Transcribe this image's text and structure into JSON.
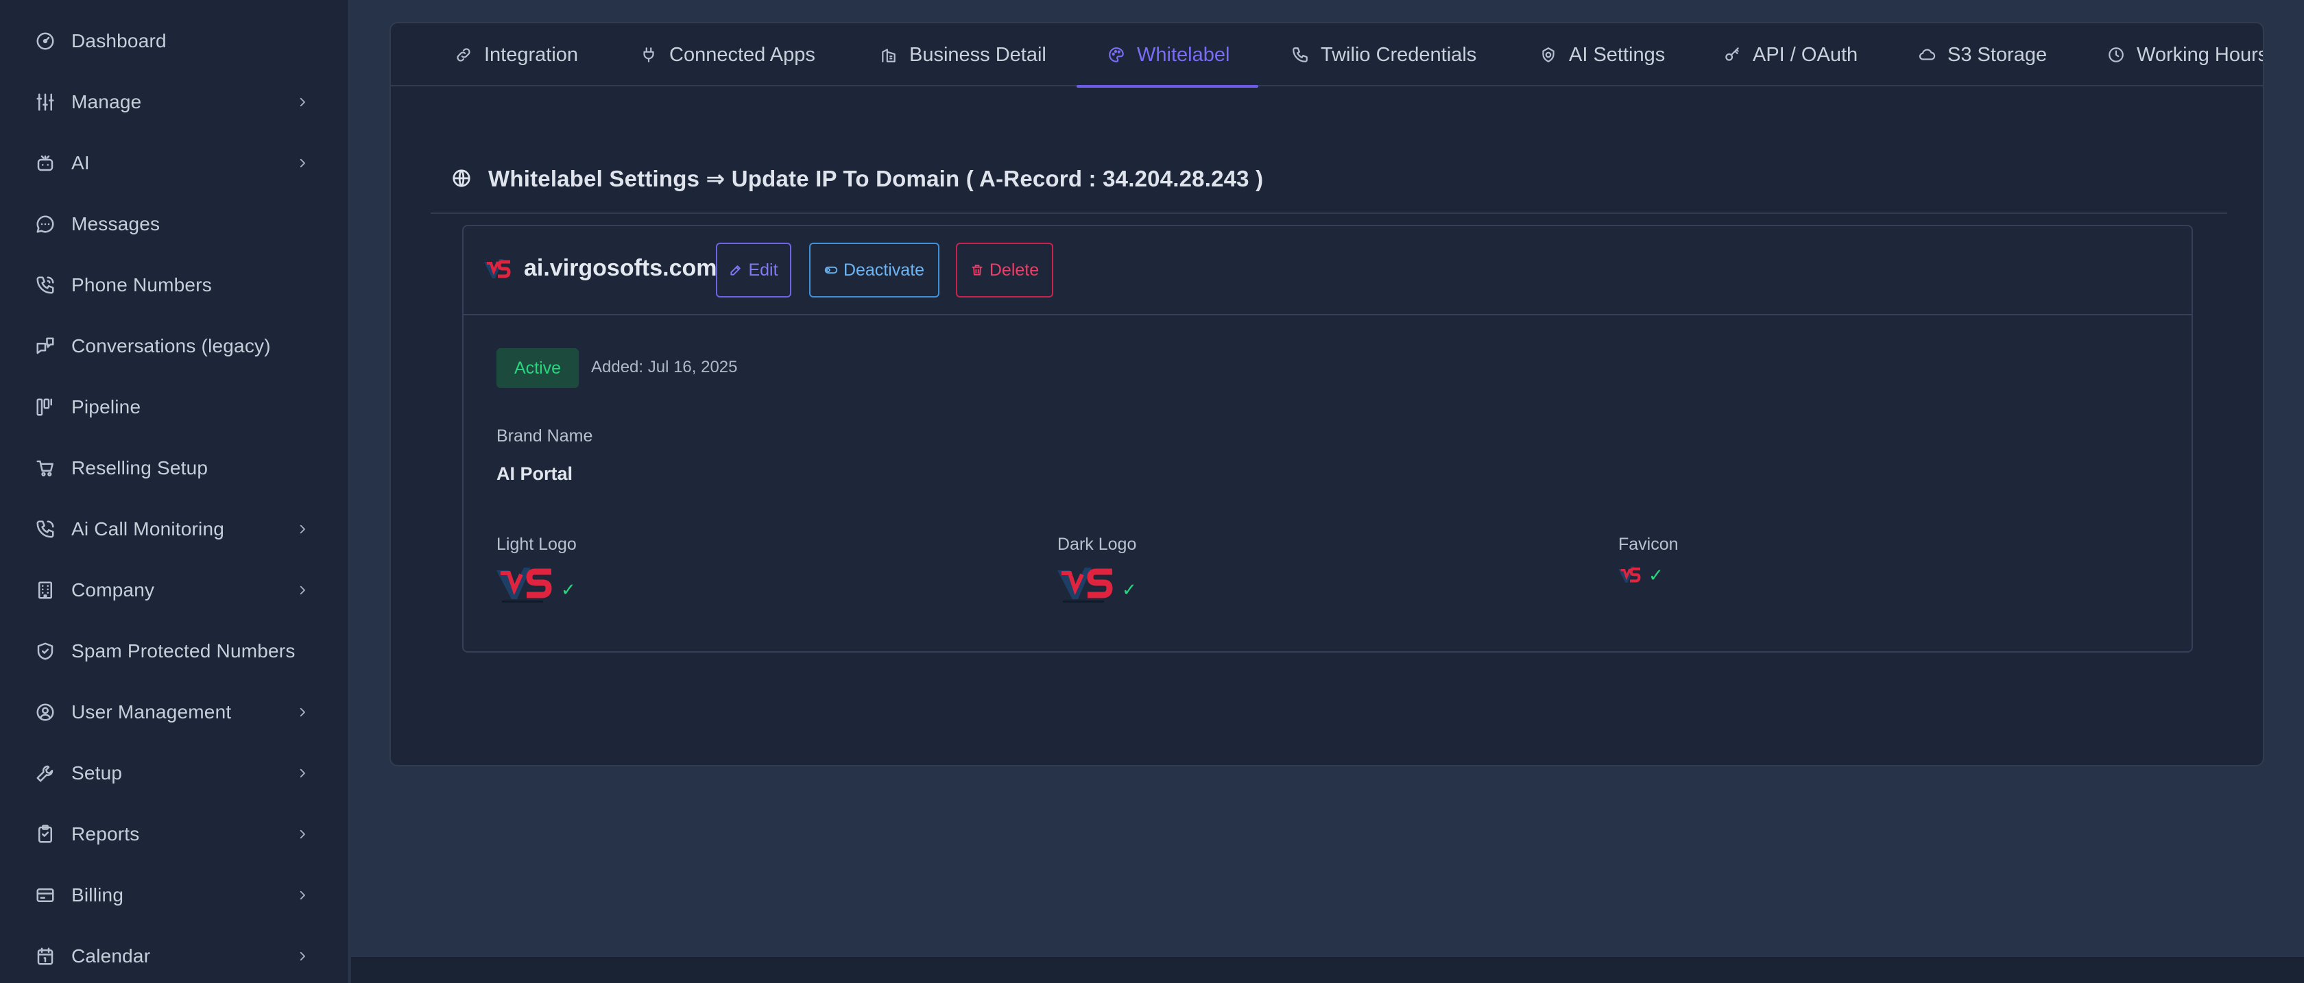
{
  "sidebar": {
    "items": [
      {
        "label": "Dashboard",
        "icon": "dashboard-icon",
        "has_children": false
      },
      {
        "label": "Manage",
        "icon": "sliders-icon",
        "has_children": true
      },
      {
        "label": "AI",
        "icon": "bot-icon",
        "has_children": true
      },
      {
        "label": "Messages",
        "icon": "chat-bubble-icon",
        "has_children": false
      },
      {
        "label": "Phone Numbers",
        "icon": "phone-icon",
        "has_children": false
      },
      {
        "label": "Conversations (legacy)",
        "icon": "conversations-icon",
        "has_children": false
      },
      {
        "label": "Pipeline",
        "icon": "pipeline-icon",
        "has_children": false
      },
      {
        "label": "Reselling Setup",
        "icon": "cart-icon",
        "has_children": false
      },
      {
        "label": "Ai Call Monitoring",
        "icon": "phone-call-icon",
        "has_children": true
      },
      {
        "label": "Company",
        "icon": "building-icon",
        "has_children": true
      },
      {
        "label": "Spam Protected Numbers",
        "icon": "shield-icon",
        "has_children": false
      },
      {
        "label": "User Management",
        "icon": "user-circle-icon",
        "has_children": true
      },
      {
        "label": "Setup",
        "icon": "wrench-icon",
        "has_children": true
      },
      {
        "label": "Reports",
        "icon": "clipboard-icon",
        "has_children": true
      },
      {
        "label": "Billing",
        "icon": "credit-card-icon",
        "has_children": true
      },
      {
        "label": "Calendar",
        "icon": "calendar-icon",
        "has_children": true
      }
    ]
  },
  "tabs": [
    {
      "label": "Integration",
      "icon": "link-icon",
      "active": false
    },
    {
      "label": "Connected Apps",
      "icon": "plug-icon",
      "active": false
    },
    {
      "label": "Business Detail",
      "icon": "building-icon",
      "active": false
    },
    {
      "label": "Whitelabel",
      "icon": "palette-icon",
      "active": true
    },
    {
      "label": "Twilio Credentials",
      "icon": "phone-icon",
      "active": false
    },
    {
      "label": "AI Settings",
      "icon": "settings-icon",
      "active": false
    },
    {
      "label": "API / OAuth",
      "icon": "key-icon",
      "active": false
    },
    {
      "label": "S3 Storage",
      "icon": "cloud-icon",
      "active": false
    },
    {
      "label": "Working Hours",
      "icon": "clock-icon",
      "active": false
    }
  ],
  "whitelabel": {
    "title": "Whitelabel Settings ⇒ Update IP To Domain ( A-Record : 34.204.28.243 )",
    "domain": {
      "name": "ai.virgosofts.com",
      "edit_label": "Edit",
      "deactivate_label": "Deactivate",
      "delete_label": "Delete",
      "status": "Active",
      "added": "Added: Jul 16, 2025",
      "brand_name_label": "Brand Name",
      "brand_name": "AI Portal",
      "light_logo_label": "Light Logo",
      "dark_logo_label": "Dark Logo",
      "favicon_label": "Favicon",
      "check_mark": "✓"
    }
  },
  "colors": {
    "accent": "#6c5ce7",
    "active_green": "#27d67e",
    "delete_red": "#ec3e68",
    "deactivate_blue": "#6cb5f5",
    "logo_red": "#e0243f",
    "logo_blue": "#1d3f66"
  }
}
